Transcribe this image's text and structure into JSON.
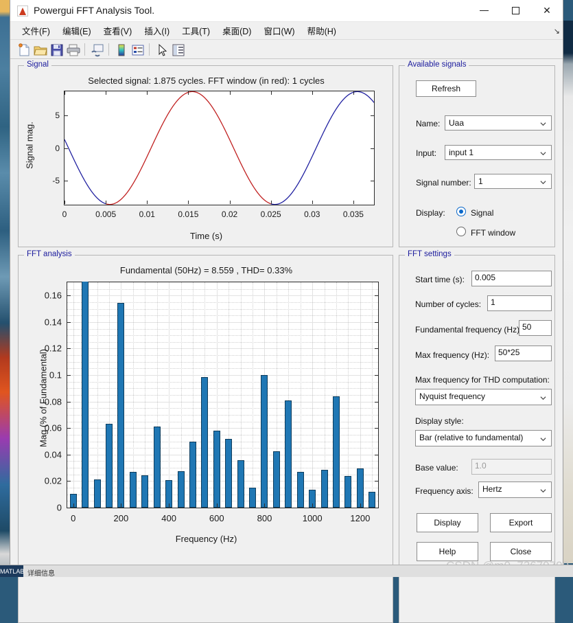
{
  "window": {
    "title": "Powergui FFT Analysis Tool.",
    "icon": "matlab-icon",
    "minimize_label": "",
    "maximize_label": "",
    "close_label": "✕"
  },
  "menubar": {
    "items": [
      {
        "label": "文件(F)",
        "name": "menu-file"
      },
      {
        "label": "编辑(E)",
        "name": "menu-edit"
      },
      {
        "label": "查看(V)",
        "name": "menu-view"
      },
      {
        "label": "插入(I)",
        "name": "menu-insert"
      },
      {
        "label": "工具(T)",
        "name": "menu-tools"
      },
      {
        "label": "桌面(D)",
        "name": "menu-desktop"
      },
      {
        "label": "窗口(W)",
        "name": "menu-window"
      },
      {
        "label": "帮助(H)",
        "name": "menu-help"
      }
    ],
    "overflow": "↘"
  },
  "toolbar": {
    "items": [
      {
        "name": "new-figure-icon"
      },
      {
        "name": "open-file-icon"
      },
      {
        "name": "save-figure-icon"
      },
      {
        "name": "print-figure-icon"
      },
      {
        "name": "link-plot-icon"
      },
      {
        "name": "colorbar-icon"
      },
      {
        "name": "legend-icon"
      },
      {
        "name": "pointer-icon"
      },
      {
        "name": "plot-browser-icon"
      }
    ]
  },
  "signal_panel": {
    "legend": "Signal"
  },
  "fft_panel": {
    "legend": "FFT analysis"
  },
  "available_signals": {
    "legend": "Available signals",
    "refresh_label": "Refresh",
    "name_label": "Name:",
    "name_value": "Uaa",
    "input_label": "Input:",
    "input_value": "input 1",
    "signal_number_label": "Signal number:",
    "signal_number_value": "1",
    "display_label": "Display:",
    "radio_signal_label": "Signal",
    "radio_fftwindow_label": "FFT window",
    "selected_display": "Signal"
  },
  "fft_settings": {
    "legend": "FFT settings",
    "start_time_label": "Start time (s):",
    "start_time_value": "0.005",
    "cycles_label": "Number of cycles:",
    "cycles_value": "1",
    "fundamental_label": "Fundamental frequency (Hz):",
    "fundamental_value": "50",
    "maxfreq_label": "Max frequency (Hz):",
    "maxfreq_value": "50*25",
    "maxfreq_thd_label": "Max frequency for THD computation:",
    "maxfreq_thd_value": "Nyquist frequency",
    "display_style_label": "Display style:",
    "display_style_value": "Bar (relative to fundamental)",
    "base_value_label": "Base value:",
    "base_value_value": "1.0",
    "freq_axis_label": "Frequency axis:",
    "freq_axis_value": "Hertz",
    "buttons": {
      "display": "Display",
      "export": "Export",
      "help": "Help",
      "close": "Close"
    }
  },
  "watermark": "CSDN @m0_73679700",
  "taskbar": {
    "app_label": "MATLAB",
    "status_text": "详细信息"
  },
  "chart_data": [
    {
      "id": "signal-plot",
      "type": "line",
      "title": "Selected signal: 1.875 cycles. FFT window (in red): 1 cycles",
      "xlabel": "Time (s)",
      "ylabel": "Signal mag.",
      "xlim": [
        0,
        0.0375
      ],
      "ylim": [
        -8.6,
        8.6
      ],
      "xticks": [
        0,
        0.005,
        0.01,
        0.015,
        0.02,
        0.025,
        0.03,
        0.035
      ],
      "xticklabels": [
        "0",
        "0.005",
        "0.01",
        "0.015",
        "0.02",
        "0.025",
        "0.03",
        "0.035"
      ],
      "yticks": [
        -5,
        0,
        5
      ],
      "yticklabels": [
        "-5",
        "0",
        "5"
      ],
      "grid": false,
      "series": [
        {
          "name": "selected-signal",
          "color": "#2020a0",
          "description": "Sinusoid amplitude 8.559, 50 Hz, 1.875 cycles, phase offset so y(0) = -1.3",
          "amplitude": 8.559,
          "frequency_hz": 50,
          "phase_deg": 171.25
        },
        {
          "name": "fft-window",
          "color": "#c02020",
          "description": "FFT window highlight (in red) from t=0.005 to t=0.025",
          "window_start_s": 0.005,
          "window_end_s": 0.025
        }
      ]
    },
    {
      "id": "fft-bar-plot",
      "type": "bar",
      "title": "Fundamental (50Hz) = 8.559 , THD= 0.33%",
      "xlabel": "Frequency (Hz)",
      "ylabel": "Mag (% of Fundamental)",
      "xlim": [
        -25,
        1275
      ],
      "ylim": [
        0,
        0.17
      ],
      "xticks": [
        0,
        200,
        400,
        600,
        800,
        1000,
        1200
      ],
      "xticklabels": [
        "0",
        "200",
        "400",
        "600",
        "800",
        "1000",
        "1200"
      ],
      "yticks": [
        0,
        0.02,
        0.04,
        0.06,
        0.08,
        0.1,
        0.12,
        0.14,
        0.16
      ],
      "yticklabels": [
        "0",
        "0.02",
        "0.04",
        "0.06",
        "0.08",
        "0.1",
        "0.12",
        "0.14",
        "0.16"
      ],
      "grid": true,
      "bar_color": "#1f77b4",
      "fundamental_clipped": true,
      "categories": [
        0,
        50,
        100,
        150,
        200,
        250,
        300,
        350,
        400,
        450,
        500,
        550,
        600,
        650,
        700,
        750,
        800,
        850,
        900,
        950,
        1000,
        1050,
        1100,
        1150,
        1200,
        1250
      ],
      "values": [
        0.0105,
        0.172,
        0.0211,
        0.0634,
        0.1546,
        0.0268,
        0.0245,
        0.0611,
        0.0206,
        0.0274,
        0.0499,
        0.0987,
        0.0583,
        0.0518,
        0.0359,
        0.015,
        0.0999,
        0.0425,
        0.081,
        0.0268,
        0.0133,
        0.0284,
        0.084,
        0.0241,
        0.0293,
        0.012
      ]
    }
  ]
}
